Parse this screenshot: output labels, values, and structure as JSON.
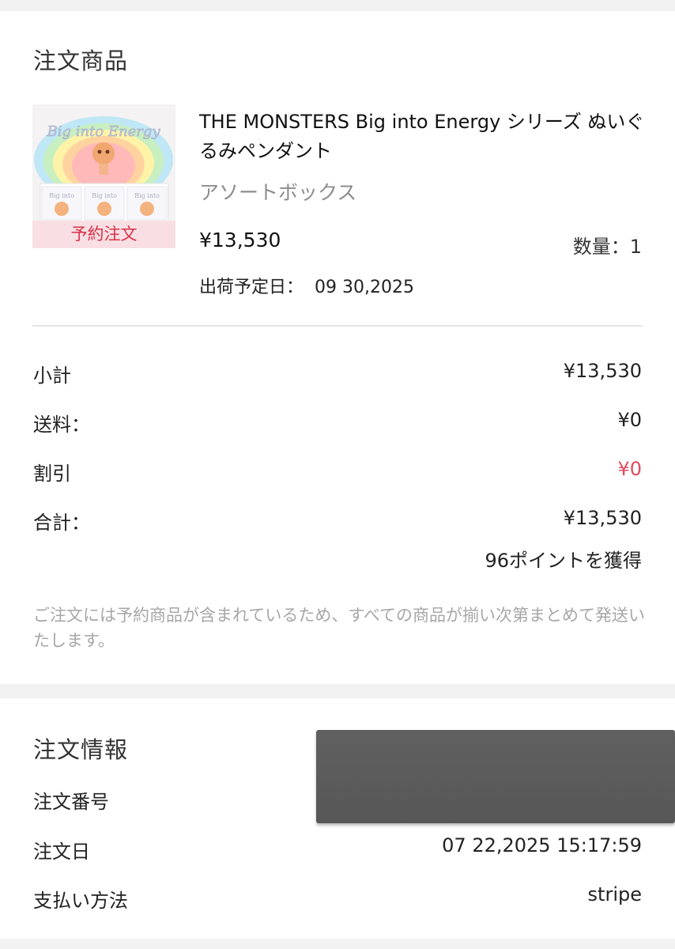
{
  "order_items": {
    "section_title": "注文商品",
    "product": {
      "badge": "予約注文",
      "title": "THE MONSTERS Big into Energy シリーズ ぬいぐるみペンダント",
      "variant": "アソートボックス",
      "price": "¥13,530",
      "quantity_label": "数量：1",
      "ship_date_label": "出荷予定日：",
      "ship_date_value": "09 30,2025",
      "thumbnail_icon": "product-box-image"
    },
    "summary": {
      "subtotal_label": "小計",
      "subtotal_value": "¥13,530",
      "shipping_label": "送料：",
      "shipping_value": "¥0",
      "discount_label": "割引",
      "discount_value": "¥0",
      "total_label": "合計：",
      "total_value": "¥13,530",
      "points": "96ポイントを獲得"
    },
    "notice": "ご注文には予約商品が含まれているため、すべての商品が揃い次第まとめて発送いたします。"
  },
  "order_info": {
    "section_title": "注文情報",
    "order_number_label": "注文番号",
    "order_date_label": "注文日",
    "order_date_value": "07 22,2025 15:17:59",
    "payment_label": "支払い方法",
    "payment_value": "stripe"
  },
  "colors": {
    "accent_red": "#e14b5f",
    "badge_bg": "#f9dfe3",
    "muted_text": "#a7a7a7",
    "page_bg": "#f2f2f2"
  }
}
